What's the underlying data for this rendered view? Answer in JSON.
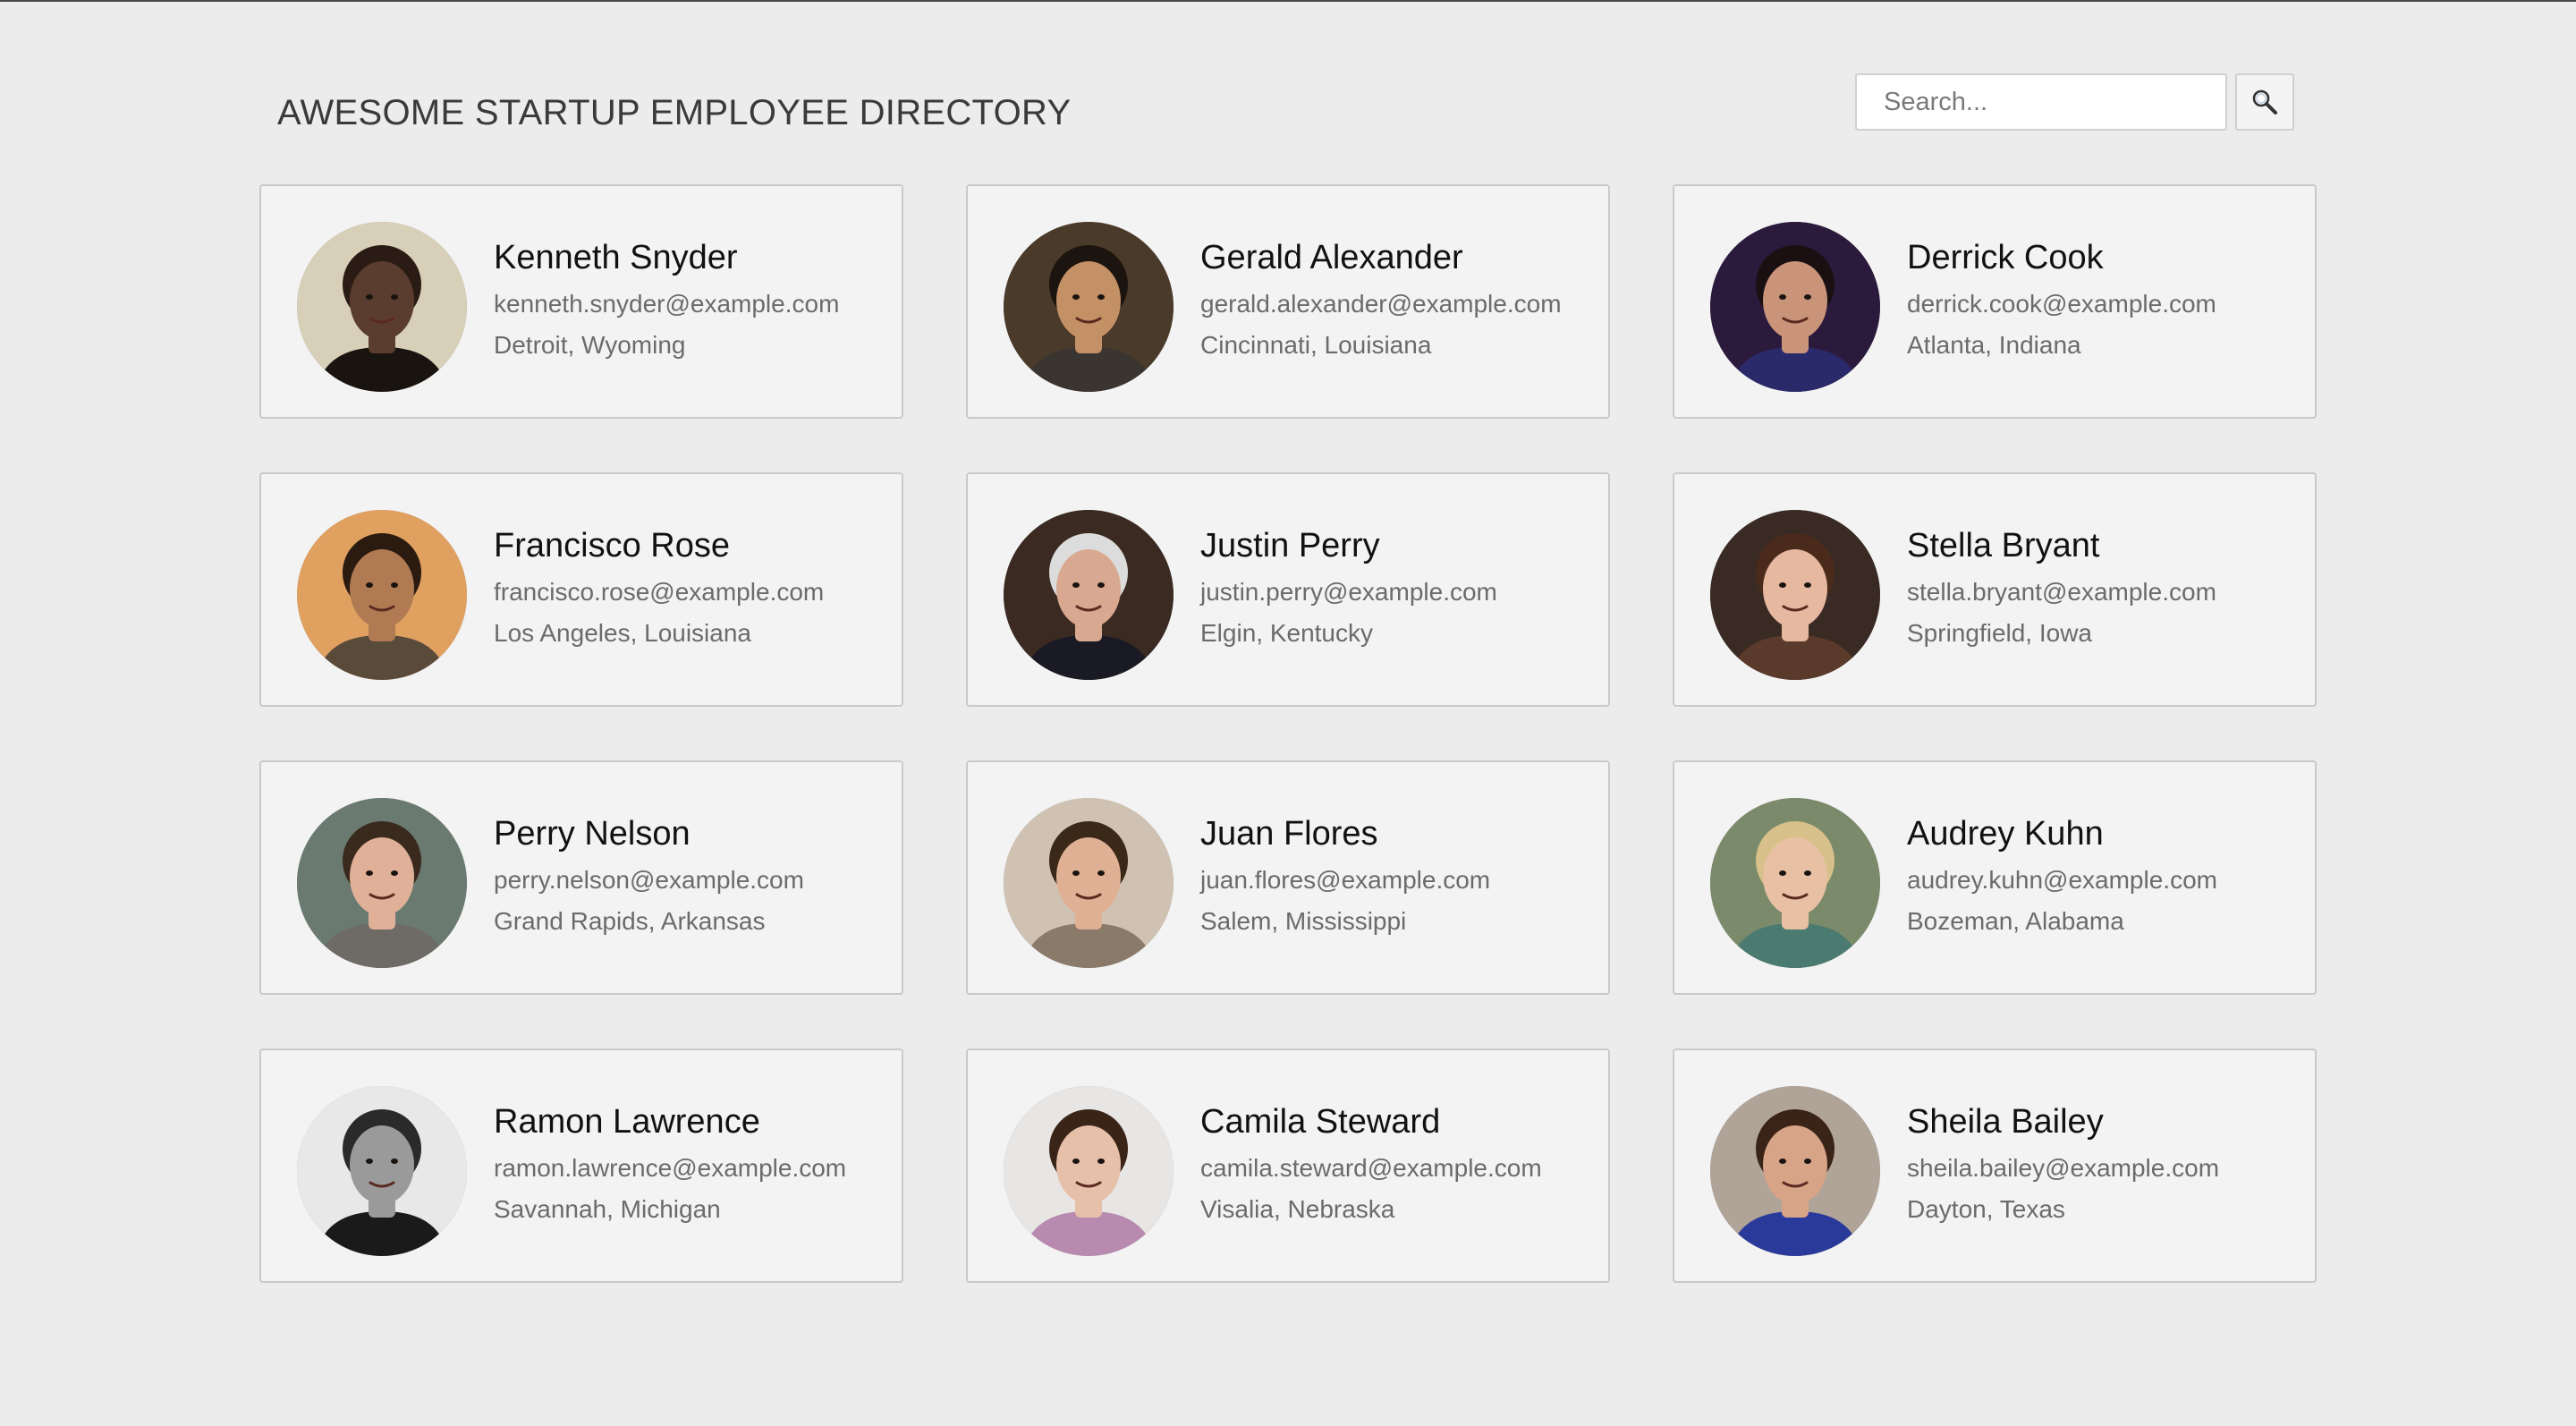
{
  "header": {
    "title": "AWESOME STARTUP EMPLOYEE DIRECTORY"
  },
  "search": {
    "placeholder": "Search...",
    "button_icon": "magnifier-icon"
  },
  "employees": [
    {
      "name": "Kenneth Snyder",
      "email": "kenneth.snyder@example.com",
      "location": "Detroit, Wyoming",
      "colors": {
        "bg": "#d8cfb8",
        "skin": "#5a3d2e",
        "hair": "#2a1c14",
        "shirt": "#1a1410"
      }
    },
    {
      "name": "Gerald Alexander",
      "email": "gerald.alexander@example.com",
      "location": "Cincinnati, Louisiana",
      "colors": {
        "bg": "#4a3a2a",
        "skin": "#c49066",
        "hair": "#1c140e",
        "shirt": "#3a3530"
      }
    },
    {
      "name": "Derrick Cook",
      "email": "derrick.cook@example.com",
      "location": "Atlanta, Indiana",
      "colors": {
        "bg": "#2c1a3c",
        "skin": "#c9947a",
        "hair": "#1a1012",
        "shirt": "#2a2a6a"
      }
    },
    {
      "name": "Francisco Rose",
      "email": "francisco.rose@example.com",
      "location": "Los Angeles, Louisiana",
      "colors": {
        "bg": "#e0a060",
        "skin": "#b07a52",
        "hair": "#2a1a10",
        "shirt": "#5a4a3a"
      }
    },
    {
      "name": "Justin Perry",
      "email": "justin.perry@example.com",
      "location": "Elgin, Kentucky",
      "colors": {
        "bg": "#3a2a22",
        "skin": "#d8a890",
        "hair": "#dcdcdc",
        "shirt": "#1a1a24"
      }
    },
    {
      "name": "Stella Bryant",
      "email": "stella.bryant@example.com",
      "location": "Springfield, Iowa",
      "colors": {
        "bg": "#3a2a24",
        "skin": "#e6b8a0",
        "hair": "#4a2a1a",
        "shirt": "#5a3a2a"
      }
    },
    {
      "name": "Perry Nelson",
      "email": "perry.nelson@example.com",
      "location": "Grand Rapids, Arkansas",
      "colors": {
        "bg": "#6a7a70",
        "skin": "#e0b098",
        "hair": "#3a2a1e",
        "shirt": "#6e6a66"
      }
    },
    {
      "name": "Juan Flores",
      "email": "juan.flores@example.com",
      "location": "Salem, Mississippi",
      "colors": {
        "bg": "#cfc2b2",
        "skin": "#e0b094",
        "hair": "#3a2818",
        "shirt": "#8a7a6a"
      }
    },
    {
      "name": "Audrey Kuhn",
      "email": "audrey.kuhn@example.com",
      "location": "Bozeman, Alabama",
      "colors": {
        "bg": "#7a8a6a",
        "skin": "#e8c0a4",
        "hair": "#d8c08a",
        "shirt": "#4a7a70"
      }
    },
    {
      "name": "Ramon Lawrence",
      "email": "ramon.lawrence@example.com",
      "location": "Savannah, Michigan",
      "colors": {
        "bg": "#e8e8e8",
        "skin": "#9a9a9a",
        "hair": "#2a2a2a",
        "shirt": "#1a1a1a"
      }
    },
    {
      "name": "Camila Steward",
      "email": "camila.steward@example.com",
      "location": "Visalia, Nebraska",
      "colors": {
        "bg": "#e8e6e4",
        "skin": "#e6c0a8",
        "hair": "#3a2418",
        "shirt": "#b88ab0"
      }
    },
    {
      "name": "Sheila Bailey",
      "email": "sheila.bailey@example.com",
      "location": "Dayton, Texas",
      "colors": {
        "bg": "#b0a498",
        "skin": "#d8a488",
        "hair": "#3a2418",
        "shirt": "#2a3a9a"
      }
    }
  ]
}
